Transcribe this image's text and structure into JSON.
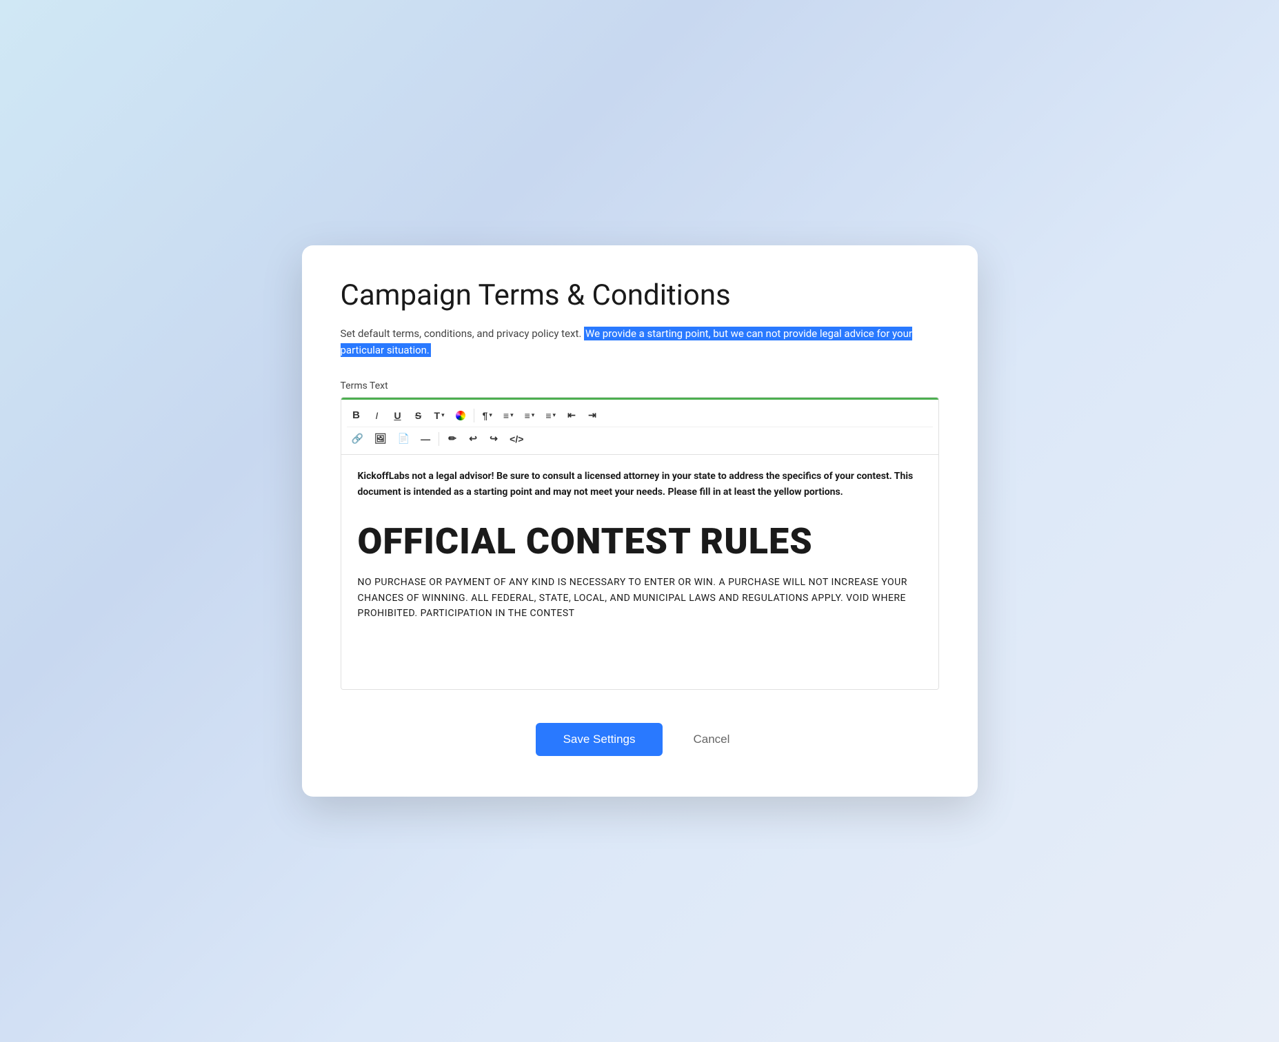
{
  "modal": {
    "title": "Campaign Terms & Conditions",
    "description_plain": "Set default terms, conditions, and privacy policy text.",
    "description_highlighted": "We provide a starting point, but we can not provide legal advice for your particular situation.",
    "terms_label": "Terms Text",
    "editor": {
      "disclaimer": "KickoffLabs not a legal advisor! Be sure to consult a licensed attorney in your state to address the specifics of your contest. This document is intended as a starting point and may not meet your needs. Please fill in at least the yellow portions.",
      "contest_title": "OFFICIAL CONTEST RULES",
      "contest_body": "NO PURCHASE OR PAYMENT OF ANY KIND IS NECESSARY TO ENTER OR WIN. A PURCHASE WILL NOT INCREASE YOUR CHANCES OF WINNING. ALL FEDERAL, STATE, LOCAL, AND MUNICIPAL LAWS AND REGULATIONS APPLY. VOID WHERE PROHIBITED. PARTICIPATION IN THE CONTEST"
    },
    "toolbar": {
      "bold": "B",
      "italic": "I",
      "underline": "U",
      "strikethrough": "S",
      "font": "T",
      "color": "color",
      "paragraph": "¶",
      "align": "≡",
      "ordered_list": "≡",
      "unordered_list": "≡",
      "indent_left": "⇤",
      "indent_right": "⇥",
      "link": "🔗",
      "image": "🖼",
      "table": "📄",
      "divider": "—",
      "brush": "✏",
      "undo": "↩",
      "redo": "↪",
      "code": "</>",
      "dropdown_arrow": "▾"
    },
    "actions": {
      "save_label": "Save Settings",
      "cancel_label": "Cancel"
    }
  }
}
